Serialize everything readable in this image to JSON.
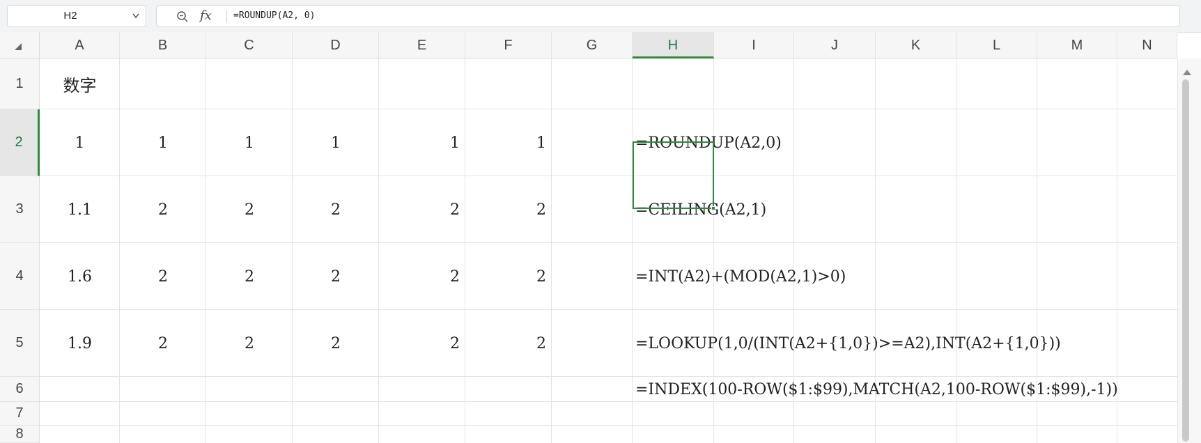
{
  "name_box": {
    "value": "H2"
  },
  "formula_bar": {
    "formula": "=ROUNDUP(A2, 0)",
    "fx_label": "fx"
  },
  "icons": {
    "zoom": "zoom-search-icon",
    "fx": "function-icon",
    "name_box_caret": "chevron-down-icon",
    "select_all": "select-all-triangle-icon",
    "scroll_up": "scroll-up-arrow-icon"
  },
  "colors": {
    "accent": "#2e8b3a",
    "header_bg": "#f6f6f6",
    "grid_line": "#e4e4e4"
  },
  "columns": [
    "A",
    "B",
    "C",
    "D",
    "E",
    "F",
    "G",
    "H",
    "I",
    "J",
    "K",
    "L",
    "M",
    "N"
  ],
  "rows": [
    "1",
    "2",
    "3",
    "4",
    "5",
    "6",
    "7",
    "8"
  ],
  "active_cell": {
    "column": "H",
    "row": "2"
  },
  "cells": {
    "A1": "数字",
    "A2": "1",
    "B2": "1",
    "C2": "1",
    "D2": "1",
    "E2": "1",
    "F2": "1",
    "H2": "=ROUNDUP(A2,0)",
    "A3": "1.1",
    "B3": "2",
    "C3": "2",
    "D3": "2",
    "E3": "2",
    "F3": "2",
    "H3": "=CEILING(A2,1)",
    "A4": "1.6",
    "B4": "2",
    "C4": "2",
    "D4": "2",
    "E4": "2",
    "F4": "2",
    "H4": "=INT(A2)+(MOD(A2,1)>0)",
    "A5": "1.9",
    "B5": "2",
    "C5": "2",
    "D5": "2",
    "E5": "2",
    "F5": "2",
    "H5": "=LOOKUP(1,0/(INT(A2+{1,0})>=A2),INT(A2+{1,0}))",
    "H6": "=INDEX(100-ROW($1:$99),MATCH(A2,100-ROW($1:$99),-1))"
  }
}
